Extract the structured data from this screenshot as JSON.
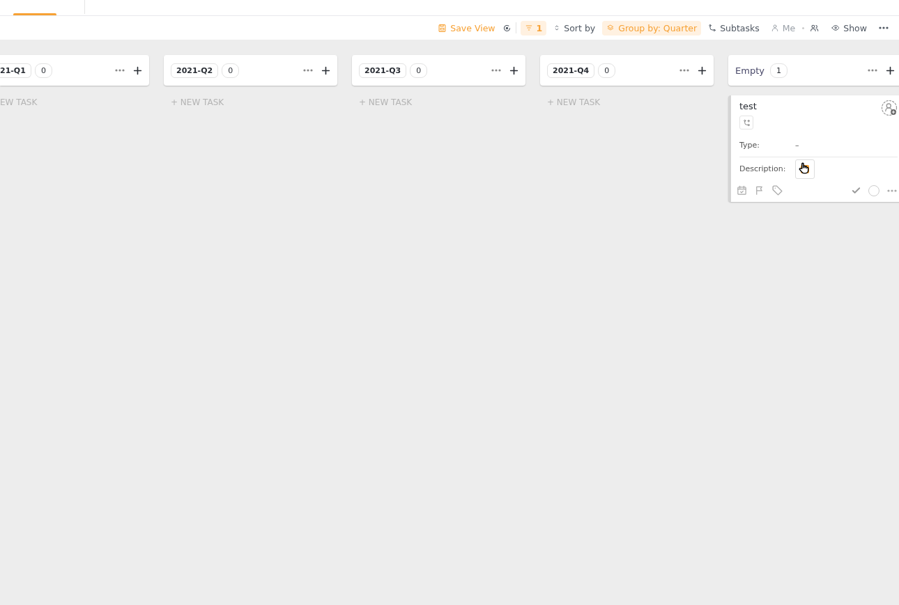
{
  "tabs": [
    {
      "selected": true
    }
  ],
  "toolbar": {
    "save_view": "Save View",
    "filter_count": "1",
    "sort": "Sort by",
    "group_by": "Group by: Quarter",
    "subtasks": "Subtasks",
    "me": "Me",
    "show": "Show"
  },
  "columns": [
    {
      "label": "21-Q1",
      "count": "0",
      "cut": true,
      "kind": "pill",
      "new_task": "EW TASK"
    },
    {
      "label": "2021-Q2",
      "count": "0",
      "cut": false,
      "kind": "pill",
      "new_task": "+ NEW TASK"
    },
    {
      "label": "2021-Q3",
      "count": "0",
      "cut": false,
      "kind": "pill",
      "new_task": "+ NEW TASK"
    },
    {
      "label": "2021-Q4",
      "count": "0",
      "cut": false,
      "kind": "pill",
      "new_task": "+ NEW TASK"
    },
    {
      "label": "Empty",
      "count": "1",
      "cut": false,
      "kind": "plain",
      "tasks": [
        {
          "title": "test",
          "fields": [
            {
              "label": "Type:",
              "value": "–"
            },
            {
              "label": "Description:",
              "kind": "color"
            }
          ]
        }
      ]
    }
  ]
}
